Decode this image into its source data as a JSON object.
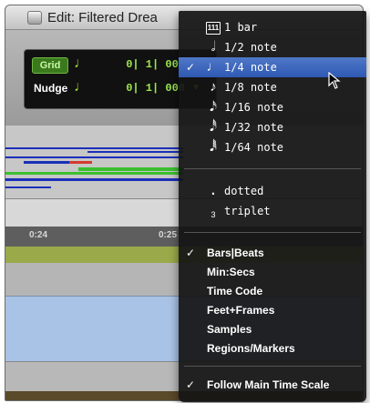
{
  "window": {
    "title": "Edit: Filtered Drea"
  },
  "counters": {
    "grid": {
      "label": "Grid",
      "value": "0| 1| 000"
    },
    "nudge": {
      "label": "Nudge",
      "value": "0| 1| 000"
    }
  },
  "ruler": {
    "ticks": [
      "0:24",
      "0:25"
    ]
  },
  "menu": {
    "note_values": [
      {
        "label": "1 bar",
        "icon": "bar-icon",
        "checked": false,
        "selected": false
      },
      {
        "label": "1/2 note",
        "icon": "half-note-icon",
        "checked": false,
        "selected": false
      },
      {
        "label": "1/4 note",
        "icon": "quarter-note-icon",
        "checked": true,
        "selected": true
      },
      {
        "label": "1/8 note",
        "icon": "eighth-note-icon",
        "checked": false,
        "selected": false
      },
      {
        "label": "1/16 note",
        "icon": "sixteenth-note-icon",
        "checked": false,
        "selected": false
      },
      {
        "label": "1/32 note",
        "icon": "thirty-second-note-icon",
        "checked": false,
        "selected": false
      },
      {
        "label": "1/64 note",
        "icon": "sixty-fourth-note-icon",
        "checked": false,
        "selected": false
      }
    ],
    "modifiers": [
      {
        "label": "dotted",
        "icon": "dot-icon"
      },
      {
        "label": "triplet",
        "icon": "triplet-icon"
      }
    ],
    "time_scales": [
      {
        "label": "Bars|Beats",
        "checked": true
      },
      {
        "label": "Min:Secs",
        "checked": false
      },
      {
        "label": "Time Code",
        "checked": false
      },
      {
        "label": "Feet+Frames",
        "checked": false
      },
      {
        "label": "Samples",
        "checked": false
      },
      {
        "label": "Regions/Markers",
        "checked": false
      }
    ],
    "follow": {
      "label": "Follow Main Time Scale",
      "checked": true
    },
    "checkmark": "✓",
    "bar_icon_text": "111",
    "dot_glyph": ".",
    "triplet_glyph": "3"
  },
  "colors": {
    "menu_bg": "#141414",
    "highlight": "#3a64bd",
    "grid_green": "#3a7a1c",
    "counter_text": "#9be84e",
    "track_green": "#9aaa4a",
    "track_blue": "#a9c3e6"
  }
}
